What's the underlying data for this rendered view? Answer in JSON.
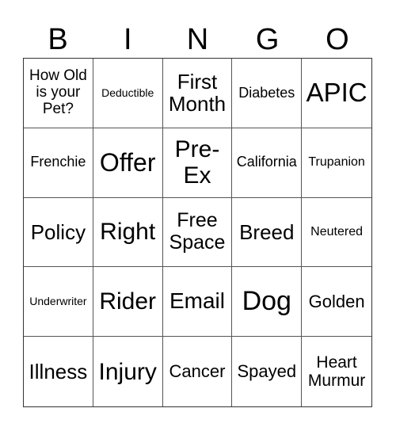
{
  "header": [
    "B",
    "I",
    "N",
    "G",
    "O"
  ],
  "cells": [
    "How Old\nis your\nPet?",
    "Deductible",
    "First\nMonth",
    "Diabetes",
    "APIC",
    "Frenchie",
    "Offer",
    "Pre-\nEx",
    "California",
    "Trupanion",
    "Policy",
    "Right",
    "Free\nSpace",
    "Breed",
    "Neutered",
    "Underwriter",
    "Rider",
    "Email",
    "Dog",
    "Golden",
    "Illness",
    "Injury",
    "Cancer",
    "Spayed",
    "Heart\nMurmur"
  ]
}
